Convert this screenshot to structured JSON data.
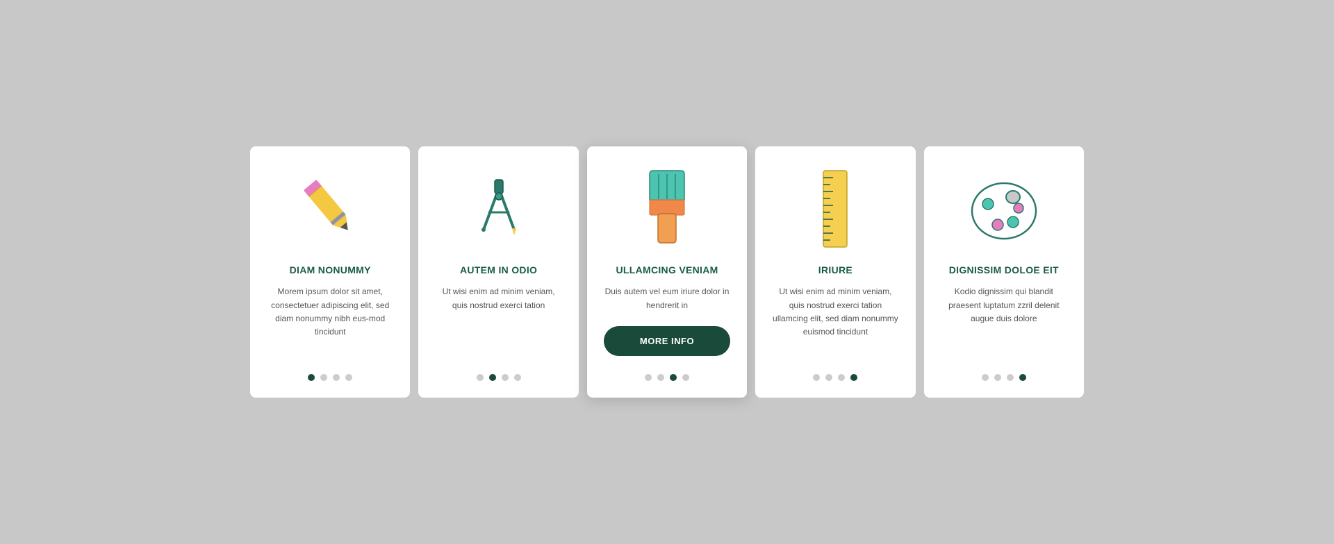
{
  "cards": [
    {
      "id": "card-1",
      "title": "DIAM NONUMMY",
      "text": "Morem ipsum dolor sit amet, consectetuer adipiscing elit, sed diam nonummy nibh eus-mod tincidunt",
      "icon": "pencil",
      "active_dot": 0,
      "dot_count": 4,
      "show_button": false,
      "button_label": ""
    },
    {
      "id": "card-2",
      "title": "AUTEM IN ODIO",
      "text": "Ut wisi enim ad minim veniam, quis nostrud exerci tation",
      "icon": "compass",
      "active_dot": 1,
      "dot_count": 4,
      "show_button": false,
      "button_label": ""
    },
    {
      "id": "card-3",
      "title": "ULLAMCING VENIAM",
      "text": "Duis autem vel eum iriure dolor in hendrerit in",
      "icon": "paintbrush",
      "active_dot": 2,
      "dot_count": 4,
      "show_button": true,
      "button_label": "MORE INFO"
    },
    {
      "id": "card-4",
      "title": "IRIURE",
      "text": "Ut wisi enim ad minim veniam, quis nostrud exerci tation ullamcing elit, sed diam nonummy euismod tincidunt",
      "icon": "ruler",
      "active_dot": 3,
      "dot_count": 4,
      "show_button": false,
      "button_label": ""
    },
    {
      "id": "card-5",
      "title": "DIGNISSIM DOLOE EIT",
      "text": "Kodio dignissim qui blandit praesent luptatum zzril delenit augue duis dolore",
      "icon": "palette",
      "active_dot": 3,
      "dot_count": 4,
      "show_button": false,
      "button_label": ""
    }
  ],
  "accent_color": "#1a4a3a"
}
